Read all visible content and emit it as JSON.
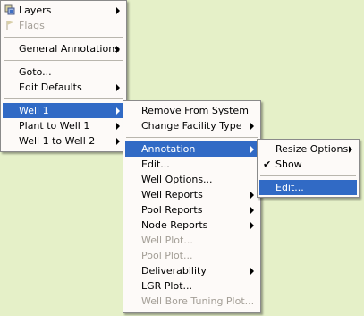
{
  "main_menu": {
    "items": [
      {
        "label": "Layers",
        "icon": "layers-icon",
        "submenu": true
      },
      {
        "label": "Flags",
        "icon": "flag-icon",
        "disabled": true
      },
      {
        "label": "General Annotations",
        "submenu": true
      },
      {
        "label": "Goto..."
      },
      {
        "label": "Edit Defaults",
        "submenu": true
      },
      {
        "label": "Well 1",
        "submenu": true,
        "selected": true
      },
      {
        "label": "Plant to Well 1",
        "submenu": true
      },
      {
        "label": "Well 1 to Well 2",
        "submenu": true
      }
    ]
  },
  "well_menu": {
    "items": [
      {
        "label": "Remove From System"
      },
      {
        "label": "Change Facility Type",
        "submenu": true
      },
      {
        "label": "Annotation",
        "submenu": true,
        "selected": true
      },
      {
        "label": "Edit..."
      },
      {
        "label": "Well Options..."
      },
      {
        "label": "Well Reports",
        "submenu": true
      },
      {
        "label": "Pool Reports",
        "submenu": true
      },
      {
        "label": "Node Reports",
        "submenu": true
      },
      {
        "label": "Well Plot...",
        "disabled": true
      },
      {
        "label": "Pool Plot...",
        "disabled": true
      },
      {
        "label": "Deliverability",
        "submenu": true
      },
      {
        "label": "LGR Plot..."
      },
      {
        "label": "Well Bore Tuning Plot...",
        "disabled": true
      }
    ]
  },
  "annotation_menu": {
    "items": [
      {
        "label": "Resize Options",
        "submenu": true
      },
      {
        "label": "Show",
        "checked": true
      },
      {
        "label": "Edit...",
        "selected": true
      }
    ]
  },
  "colors": {
    "background": "#e5f0c8",
    "menu_bg": "#fdfaf8",
    "selection": "#316ac5",
    "disabled_text": "#a39e96"
  }
}
